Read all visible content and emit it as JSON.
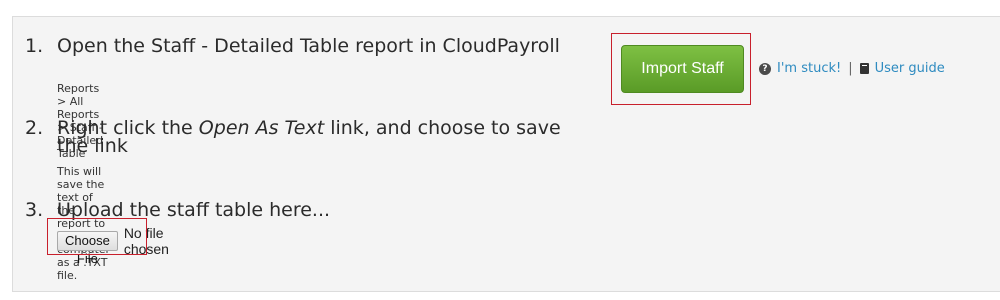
{
  "steps": [
    {
      "number": "1.",
      "title": "Open the Staff - Detailed Table report in CloudPayroll",
      "breadcrumb": "Reports > All Reports > Staff - Detailed Table"
    },
    {
      "number": "2.",
      "title_before": "Right click the ",
      "title_emphasis": "Open As Text",
      "title_after": " link, and choose to save the link",
      "note": "This will save the text of the report to your computer as a .TXT file."
    },
    {
      "number": "3.",
      "title": "Upload the staff table here...",
      "file_button_label": "Choose File",
      "file_status": "No file chosen"
    }
  ],
  "import_button": {
    "label": "Import Staff",
    "color": "#6aad33"
  },
  "help": {
    "stuck_label": "I'm stuck!",
    "separator": "|",
    "guide_label": "User guide",
    "stuck_icon": "question-circle-icon",
    "guide_icon": "book-icon"
  },
  "colors": {
    "link": "#2e8bc0",
    "highlight": "#c8202c",
    "panel_bg": "#f4f4f4"
  }
}
